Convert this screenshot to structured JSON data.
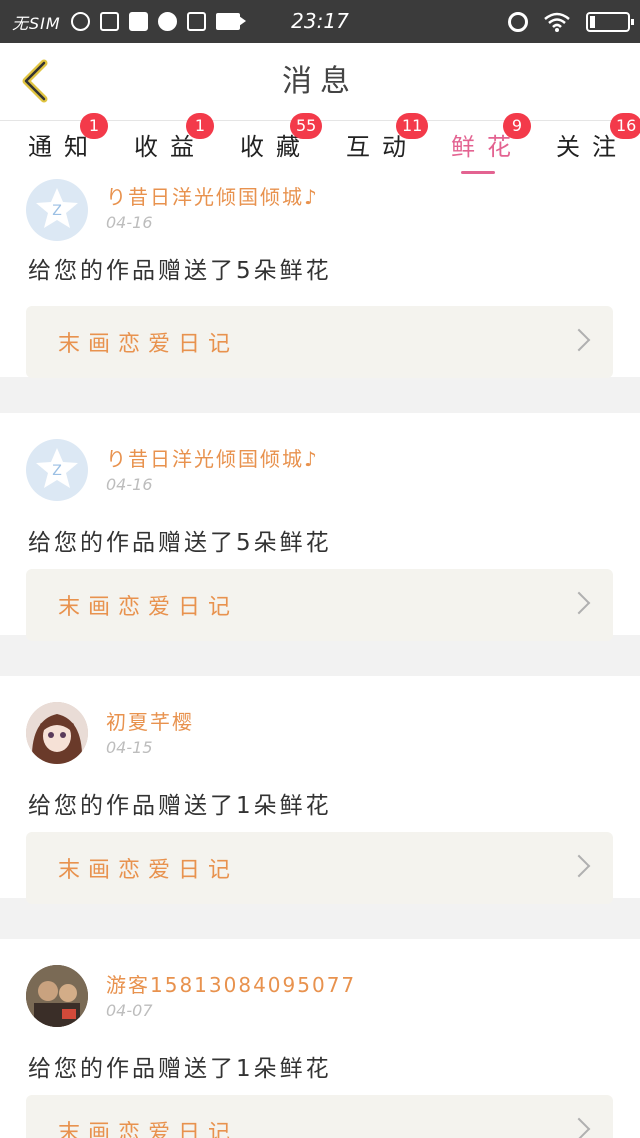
{
  "status_bar": {
    "carrier": "无SIM",
    "time": "23:17"
  },
  "header": {
    "title": "消息"
  },
  "tabs": [
    {
      "label": "通知",
      "badge": "1"
    },
    {
      "label": "收益",
      "badge": "1"
    },
    {
      "label": "收藏",
      "badge": "55"
    },
    {
      "label": "互动",
      "badge": "11"
    },
    {
      "label": "鲜花",
      "badge": "9",
      "active": true
    },
    {
      "label": "关注",
      "badge": "16"
    }
  ],
  "messages": [
    {
      "username": "り昔日洋光倾国倾城♪",
      "date": "04-16",
      "text": "给您的作品赠送了5朵鲜花",
      "work_title": "末画恋爱日记",
      "avatar": "default-z-icon"
    },
    {
      "username": "り昔日洋光倾国倾城♪",
      "date": "04-16",
      "text": "给您的作品赠送了5朵鲜花",
      "work_title": "末画恋爱日记",
      "avatar": "default-z-icon"
    },
    {
      "username": "初夏芊樱",
      "date": "04-15",
      "text": "给您的作品赠送了1朵鲜花",
      "work_title": "末画恋爱日记",
      "avatar": "anime-girl-avatar"
    },
    {
      "username": "游客15813084095077",
      "date": "04-07",
      "text": "给您的作品赠送了1朵鲜花",
      "work_title": "末画恋爱日记",
      "avatar": "photo-avatar"
    }
  ],
  "colors": {
    "accent_pink": "#e36391",
    "badge_red": "#f33a4a",
    "username_orange": "#e8924e"
  }
}
